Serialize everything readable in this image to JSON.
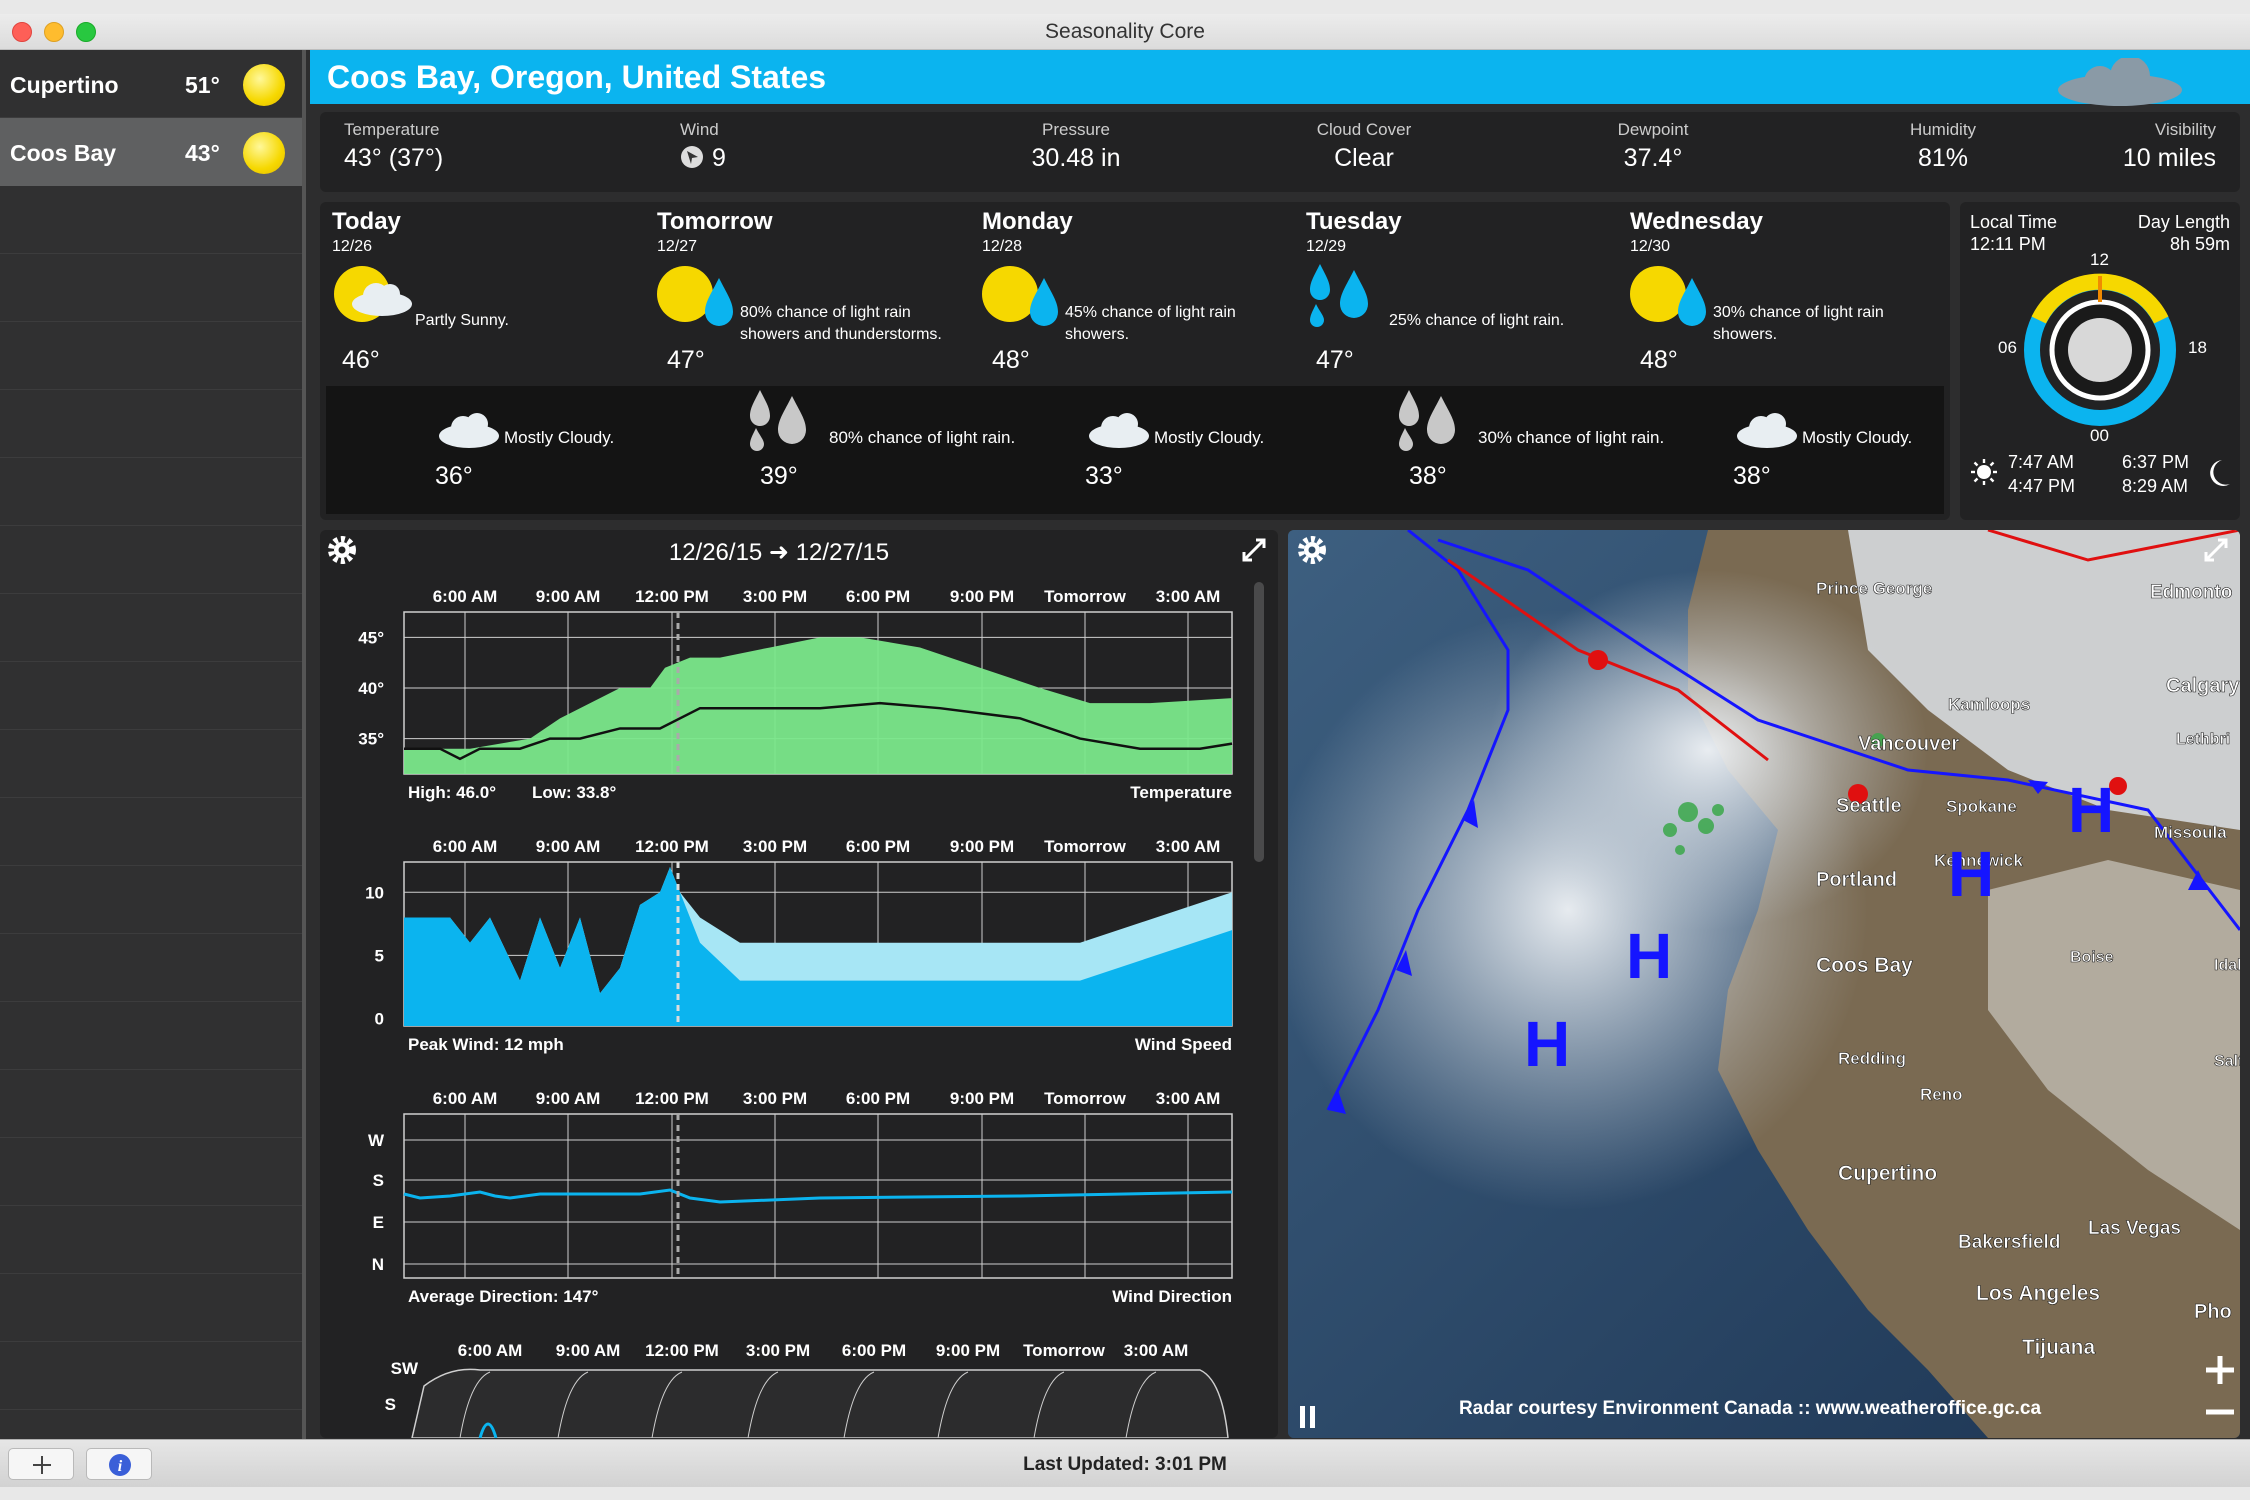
{
  "window": {
    "title": "Seasonality Core"
  },
  "sidebar": {
    "locations": [
      {
        "name": "Cupertino",
        "temp": "51°"
      },
      {
        "name": "Coos Bay",
        "temp": "43°"
      }
    ]
  },
  "header": {
    "location": "Coos Bay, Oregon, United States"
  },
  "conditions": [
    {
      "label": "Temperature",
      "value": "43° (37°)"
    },
    {
      "label": "Wind",
      "value": "9"
    },
    {
      "label": "Pressure",
      "value": "30.48 in"
    },
    {
      "label": "Cloud Cover",
      "value": "Clear"
    },
    {
      "label": "Dewpoint",
      "value": "37.4°"
    },
    {
      "label": "Humidity",
      "value": "81%"
    },
    {
      "label": "Visibility",
      "value": "10 miles"
    }
  ],
  "forecast": {
    "days": [
      {
        "name": "Today",
        "date": "12/26",
        "icon": "partly-sunny-icon",
        "text": "Partly Sunny.",
        "high": "46°"
      },
      {
        "name": "Tomorrow",
        "date": "12/27",
        "icon": "sun-rain-icon",
        "text": "80% chance of light rain showers and thunderstorms.",
        "high": "47°"
      },
      {
        "name": "Monday",
        "date": "12/28",
        "icon": "sun-rain-icon",
        "text": "45% chance of light rain showers.",
        "high": "48°"
      },
      {
        "name": "Tuesday",
        "date": "12/29",
        "icon": "rain-icon",
        "text": "25% chance of light rain.",
        "high": "47°"
      },
      {
        "name": "Wednesday",
        "date": "12/30",
        "icon": "sun-rain-icon",
        "text": "30% chance of light rain showers.",
        "high": "48°"
      }
    ],
    "nights": [
      {
        "icon": "moon-cloud-icon",
        "text": "Mostly Cloudy.",
        "low": "36°"
      },
      {
        "icon": "rain-drops-icon",
        "text": "80% chance of light rain.",
        "low": "39°"
      },
      {
        "icon": "moon-cloud-icon",
        "text": "Mostly Cloudy.",
        "low": "33°"
      },
      {
        "icon": "rain-drops-icon",
        "text": "30% chance of light rain.",
        "low": "38°"
      },
      {
        "icon": "moon-cloud-icon",
        "text": "Mostly Cloudy.",
        "low": "38°"
      }
    ]
  },
  "clock": {
    "local_time_label": "Local Time",
    "local_time": "12:11 PM",
    "day_length_label": "Day Length",
    "day_length": "8h 59m",
    "dial_labels": {
      "top": "12",
      "right": "18",
      "bottom": "00",
      "left": "06"
    },
    "sunrise": "7:47 AM",
    "sunset": "4:47 PM",
    "moonrise": "6:37 PM",
    "moonset": "8:29 AM"
  },
  "graphs": {
    "date_range": "12/26/15 ➜ 12/27/15",
    "time_labels": [
      "6:00 AM",
      "9:00 AM",
      "12:00 PM",
      "3:00 PM",
      "6:00 PM",
      "9:00 PM",
      "Tomorrow",
      "3:00 AM"
    ],
    "temperature": {
      "y_ticks": [
        "45°",
        "40°",
        "35°"
      ],
      "high_text": "High: 46.0°",
      "low_text": "Low: 33.8°",
      "title": "Temperature"
    },
    "wind_speed": {
      "y_ticks": [
        "10",
        "5",
        "0"
      ],
      "peak_text": "Peak Wind: 12 mph",
      "title": "Wind Speed"
    },
    "wind_direction": {
      "y_ticks": [
        "W",
        "S",
        "E",
        "N"
      ],
      "avg_text": "Average Direction: 147°",
      "title": "Wind Direction"
    },
    "swell": {
      "y_ticks": [
        "SW",
        "S"
      ]
    }
  },
  "radar": {
    "cities": [
      "Prince George",
      "Edmonto",
      "Calgary",
      "Kamloops",
      "Lethbri",
      "Vancouver",
      "Seattle",
      "Spokane",
      "Missoula",
      "Kennewick",
      "Portland",
      "Boise",
      "Coos Bay",
      "Idal",
      "Redding",
      "Reno",
      "Salt",
      "Cupertino",
      "Las Vegas",
      "Bakersfield",
      "Los Angeles",
      "Pho",
      "Tijuana"
    ],
    "pressure_label": "H",
    "credit": "Radar courtesy Environment Canada :: www.weatheroffice.gc.ca"
  },
  "status": {
    "last_updated": "Last Updated: 3:01 PM"
  }
}
